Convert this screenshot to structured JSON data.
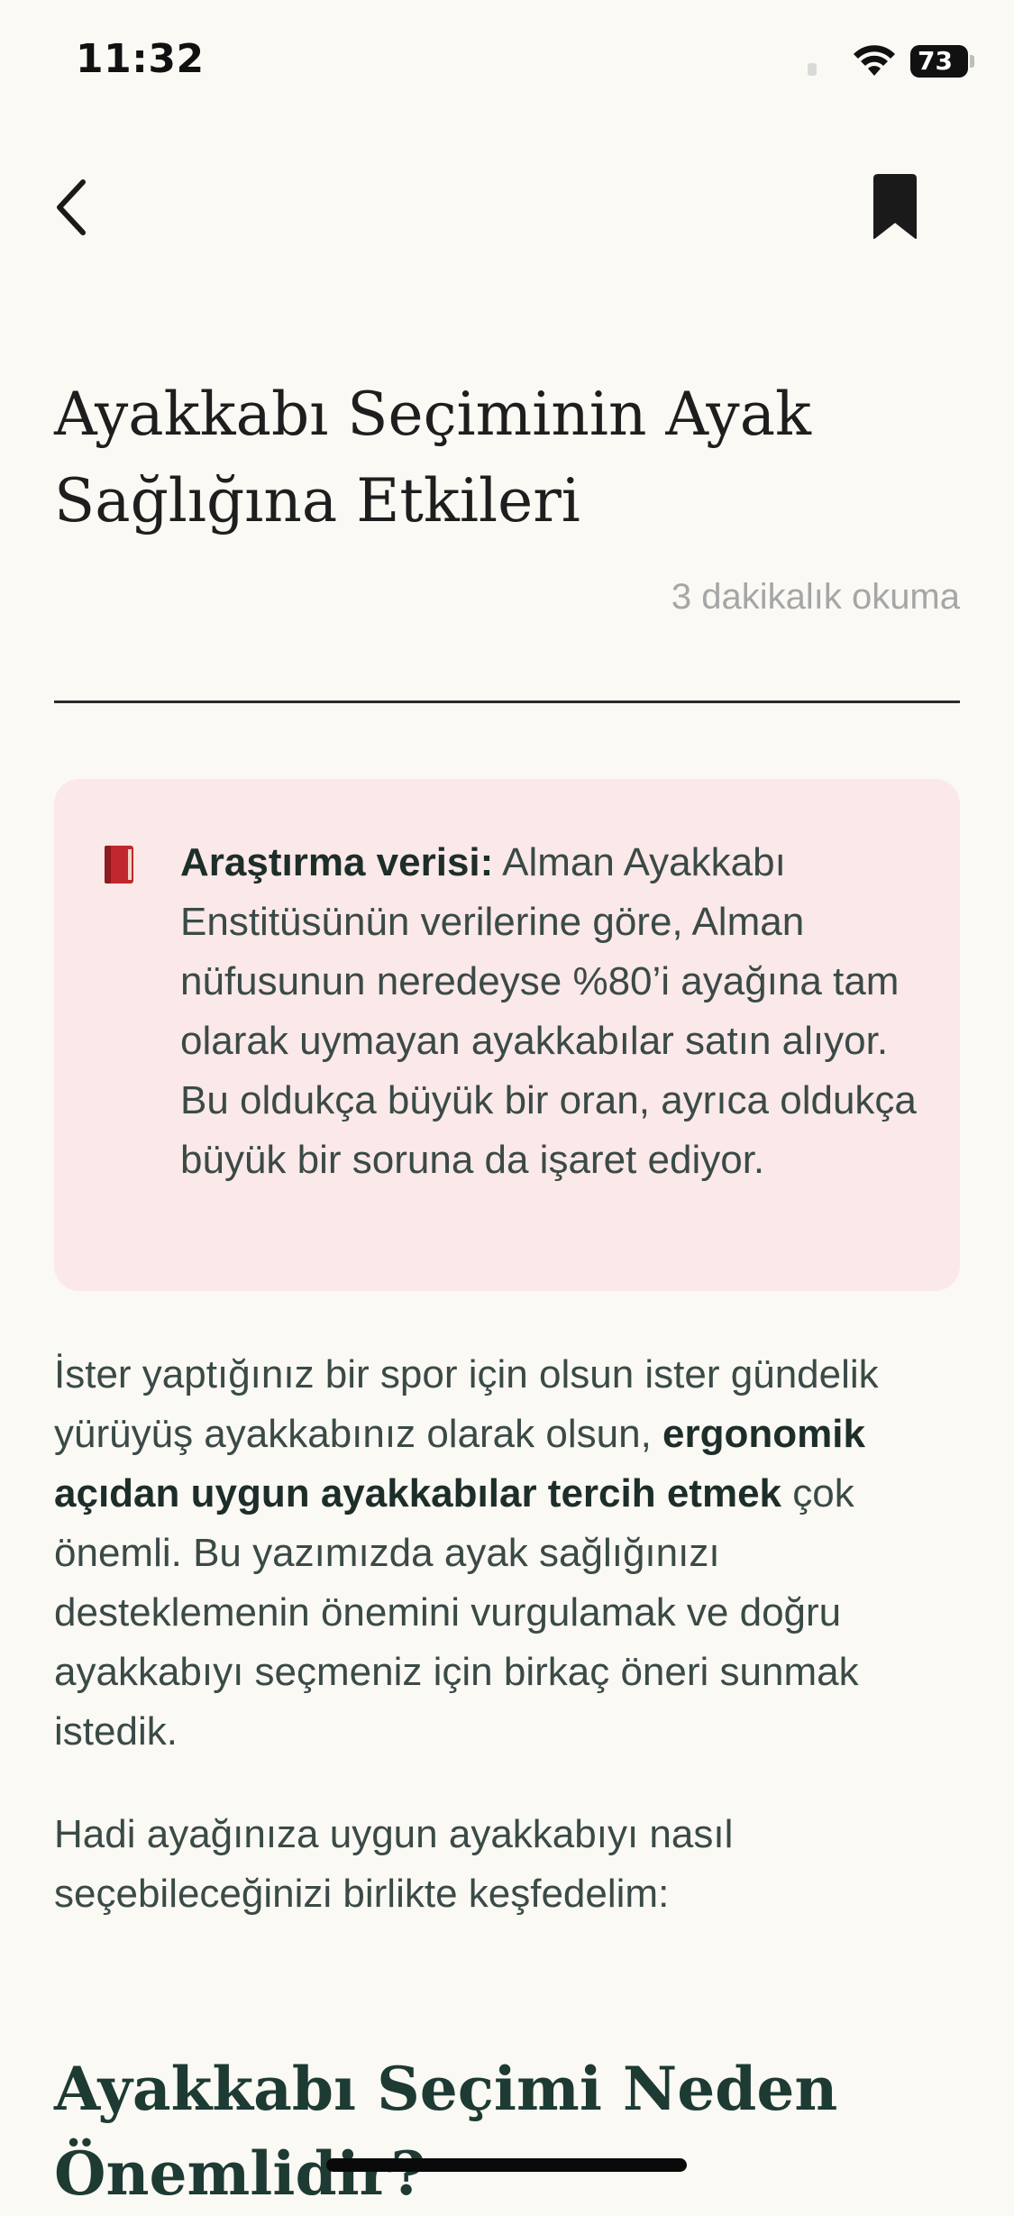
{
  "status_bar": {
    "time": "11:32",
    "battery": "73"
  },
  "icons": {
    "back": "chevron-left-icon",
    "bookmark": "bookmark-icon",
    "callout": "red-book-icon",
    "wifi": "wifi-icon"
  },
  "article": {
    "title": "Ayakkabı Seçiminin Ayak Sağlığına Etkileri",
    "read_time": "3 dakikalık okuma",
    "callout": {
      "label": "Araştırma verisi:",
      "text": " Alman Ayakkabı Enstitüsünün verilerine göre, Alman nüfusunun neredeyse %80’i ayağına tam olarak uymayan ayakkabılar satın alıyor. Bu oldukça büyük bir oran, ayrıca oldukça büyük bir soruna da işaret ediyor."
    },
    "paragraph_1": {
      "part1": "İster yaptığınız bir spor için olsun ister gündelik yürüyüş ayakkabınız olarak olsun, ",
      "bold": "ergonomik açıdan uygun ayakkabılar tercih etmek",
      "part2": " çok önemli. Bu yazımızda ayak sağlığınızı desteklemenin önemini vurgulamak ve doğru ayakkabıyı seçmeniz için birkaç öneri sunmak istedik."
    },
    "paragraph_2": "Hadi ayağınıza uygun ayakkabıyı nasıl seçebileceğinizi birlikte keşfedelim:",
    "section_heading": "Ayakkabı Seçimi Neden Önemlidir?"
  },
  "colors": {
    "background": "#FBF9F4",
    "callout_bg": "#FBE8E8",
    "heading_green": "#1D3A33",
    "body_text": "#3A4A47"
  }
}
